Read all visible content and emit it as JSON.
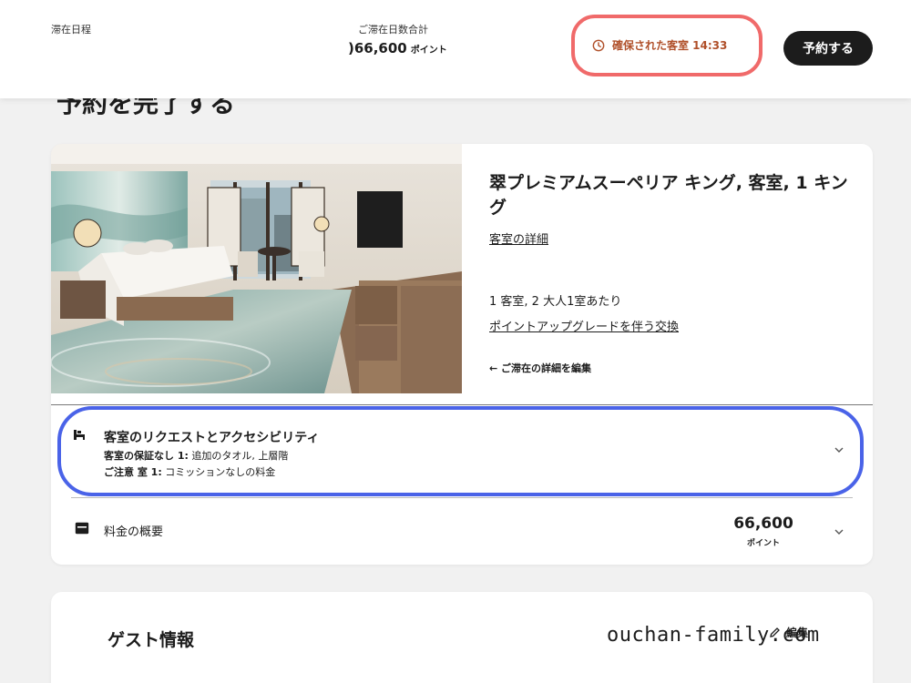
{
  "header": {
    "stay_dates_label": "滞在日程",
    "total_label": "ご滞在日数合計",
    "total_value": ")66,600",
    "total_unit": "ポイント",
    "hold_timer": "確保された客室 14:33",
    "book_button": "予約する"
  },
  "page": {
    "heading": "予約を完了する"
  },
  "room": {
    "name": "翠プレミアムスーペリア キング, 客室, 1 キング",
    "details_link": "客室の詳細",
    "occupancy": "1 客室, 2 大人1室あたり",
    "upgrade_link": "ポイントアップグレードを伴う交換",
    "edit_stay_link": "← ご滞在の詳細を編集"
  },
  "requests": {
    "title": "客室のリクエストとアクセシビリティ",
    "line1_label": "客室の保証なし 1:",
    "line1_value": " 追加のタオル, 上層階",
    "line2_label": "ご注意 室 1:",
    "line2_value": " コミッションなしの料金"
  },
  "price": {
    "label": "料金の概要",
    "value": "66,600",
    "unit": "ポイント"
  },
  "guest": {
    "title": "ゲスト情報",
    "edit": "編集"
  },
  "watermark": "ouchan-family.com",
  "colors": {
    "hold_timer": "#b0502a",
    "hold_highlight": "#f06a6a",
    "requests_highlight": "#4a63e8",
    "button_bg": "#1c1c1c"
  },
  "icons": {
    "hold_timer": "clock-icon",
    "requests": "bed-icon",
    "price": "wallet-icon",
    "chevron": "chevron-down-icon",
    "edit": "pencil-icon"
  }
}
